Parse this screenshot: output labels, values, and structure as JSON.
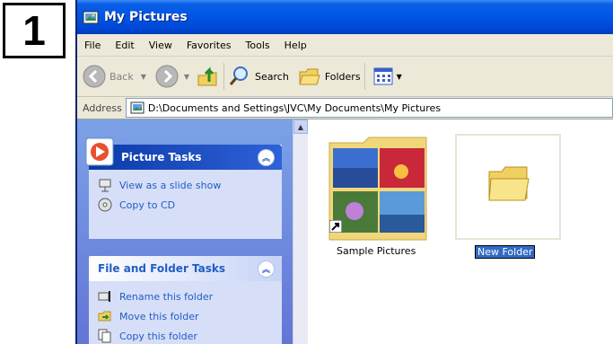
{
  "step_number": "1",
  "window": {
    "title": "My Pictures"
  },
  "menu": [
    "File",
    "Edit",
    "View",
    "Favorites",
    "Tools",
    "Help"
  ],
  "toolbar": {
    "back_label": "Back",
    "search_label": "Search",
    "folders_label": "Folders"
  },
  "address": {
    "label": "Address",
    "path": "D:\\Documents and Settings\\JVC\\My Documents\\My Pictures"
  },
  "picture_tasks": {
    "title": "Picture Tasks",
    "items": [
      "View as a slide show",
      "Copy to CD"
    ]
  },
  "file_folder_tasks": {
    "title": "File and Folder Tasks",
    "items": [
      "Rename this folder",
      "Move this folder",
      "Copy this folder"
    ]
  },
  "files": [
    {
      "name": "Sample Pictures"
    },
    {
      "name": "New Folder"
    }
  ]
}
